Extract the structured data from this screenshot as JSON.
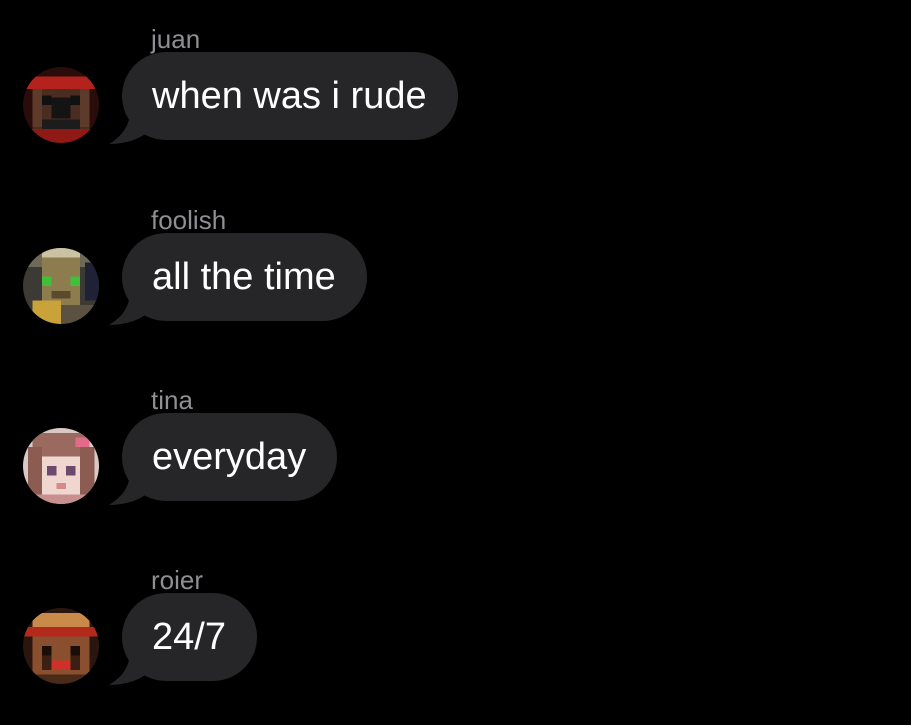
{
  "messages": [
    {
      "sender": "juan",
      "text": "when was i rude",
      "avatar_icon": "pixel-avatar-juan"
    },
    {
      "sender": "foolish",
      "text": "all the time",
      "avatar_icon": "pixel-avatar-foolish"
    },
    {
      "sender": "tina",
      "text": "everyday",
      "avatar_icon": "pixel-avatar-tina"
    },
    {
      "sender": "roier",
      "text": "24/7",
      "avatar_icon": "pixel-avatar-roier"
    }
  ],
  "colors": {
    "background": "#000000",
    "bubble": "#262628",
    "sender_name": "#8e8e93",
    "message_text": "#ffffff"
  }
}
